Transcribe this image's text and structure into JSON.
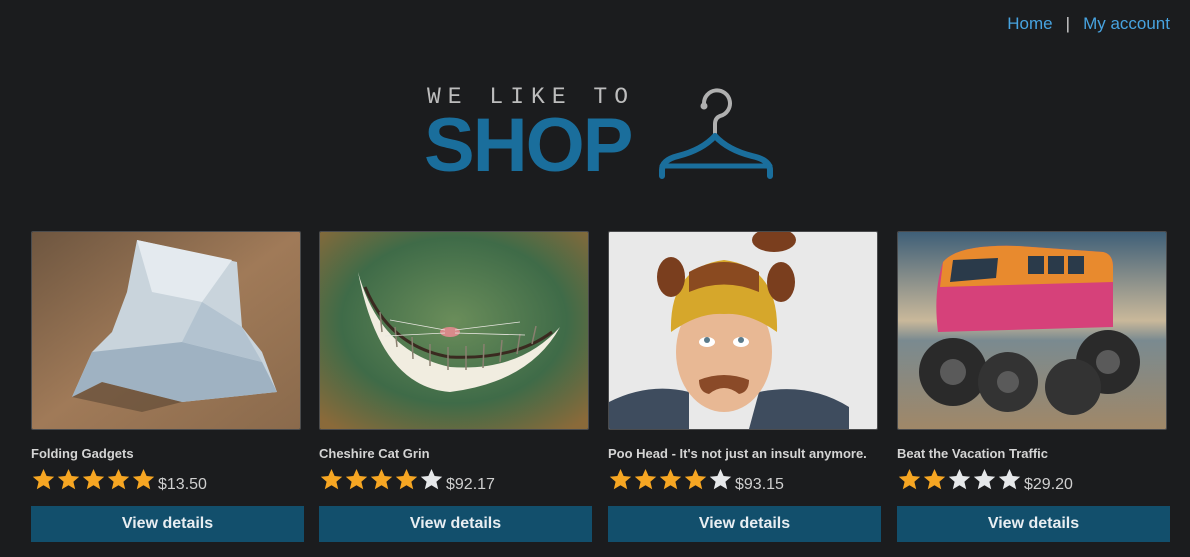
{
  "nav": {
    "home": "Home",
    "separator": "|",
    "account": "My account"
  },
  "logo": {
    "top_text": "WE LIKE TO",
    "main_text": "SHOP",
    "icon": "hanger-icon",
    "brand_color": "#1a6e9c"
  },
  "products": [
    {
      "title": "Folding Gadgets",
      "rating": 5,
      "max_rating": 5,
      "price": "$13.50",
      "button": "View details",
      "image": "origami-euro-note-image"
    },
    {
      "title": "Cheshire Cat Grin",
      "rating": 4,
      "max_rating": 5,
      "price": "$92.17",
      "button": "View details",
      "image": "cheshire-grin-image"
    },
    {
      "title": "Poo Head - It's not just an insult anymore.",
      "rating": 4,
      "max_rating": 5,
      "price": "$93.15",
      "button": "View details",
      "image": "poo-head-hat-image"
    },
    {
      "title": "Beat the Vacation Traffic",
      "rating": 2,
      "max_rating": 5,
      "price": "$29.20",
      "button": "View details",
      "image": "monster-van-image"
    }
  ],
  "colors": {
    "background": "#1b1c1e",
    "link": "#47a3e0",
    "button": "#124f6c",
    "star_filled": "#f6a623",
    "star_empty": "#e6e8ea"
  }
}
